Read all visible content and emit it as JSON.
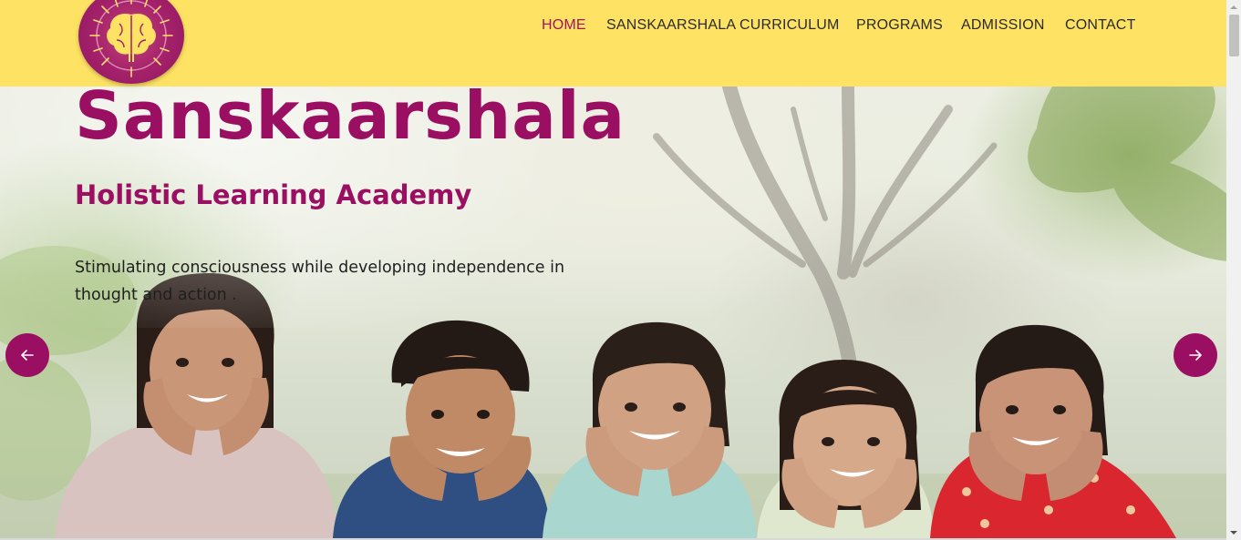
{
  "header": {
    "logo_name": "brain-logo",
    "nav": [
      {
        "label": "HOME",
        "active": true
      },
      {
        "label": "SANSKAARSHALA  CURRICULUM",
        "active": false
      },
      {
        "label": "PROGRAMS",
        "active": false
      },
      {
        "label": "ADMISSION",
        "active": false
      },
      {
        "label": "CONTACT",
        "active": false
      }
    ]
  },
  "hero": {
    "title": "Sanskaarshala",
    "subtitle": "Holistic Learning Academy",
    "description": "Stimulating consciousness while developing independence in thought and action .",
    "prev_icon": "arrow-left-icon",
    "next_icon": "arrow-right-icon"
  },
  "colors": {
    "header_bg": "#fde263",
    "brand": "#9b0f63",
    "nav_active": "#a3155f"
  }
}
